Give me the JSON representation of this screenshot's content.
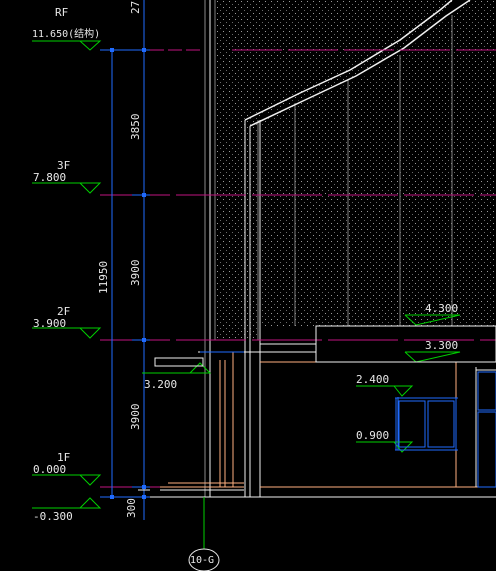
{
  "levels": [
    {
      "floor": "RF",
      "elevation": "11.650(结构)"
    },
    {
      "floor": "3F",
      "elevation": "7.800"
    },
    {
      "floor": "2F",
      "elevation": "3.900"
    },
    {
      "floor": "1F",
      "elevation": "0.000"
    },
    {
      "floor": "",
      "elevation": "-0.300"
    }
  ],
  "dims": {
    "top_partial": "27",
    "d_3850": "3850",
    "d_3900_upper": "3900",
    "total": "11950",
    "d_3900_lower": "3900",
    "d_300": "300"
  },
  "marks": {
    "canopy": "3.200",
    "box_top": "4.300",
    "box_bottom": "3.300",
    "win_top": "2.400",
    "win_bottom": "0.900"
  },
  "axis": {
    "label": "10-G"
  },
  "colors": {
    "blue": "#1f6bff",
    "magenta": "#c0147f",
    "green": "#00d000",
    "orange": "#ffb080",
    "white": "#f0f0f0",
    "grey": "#8a8a8a"
  }
}
